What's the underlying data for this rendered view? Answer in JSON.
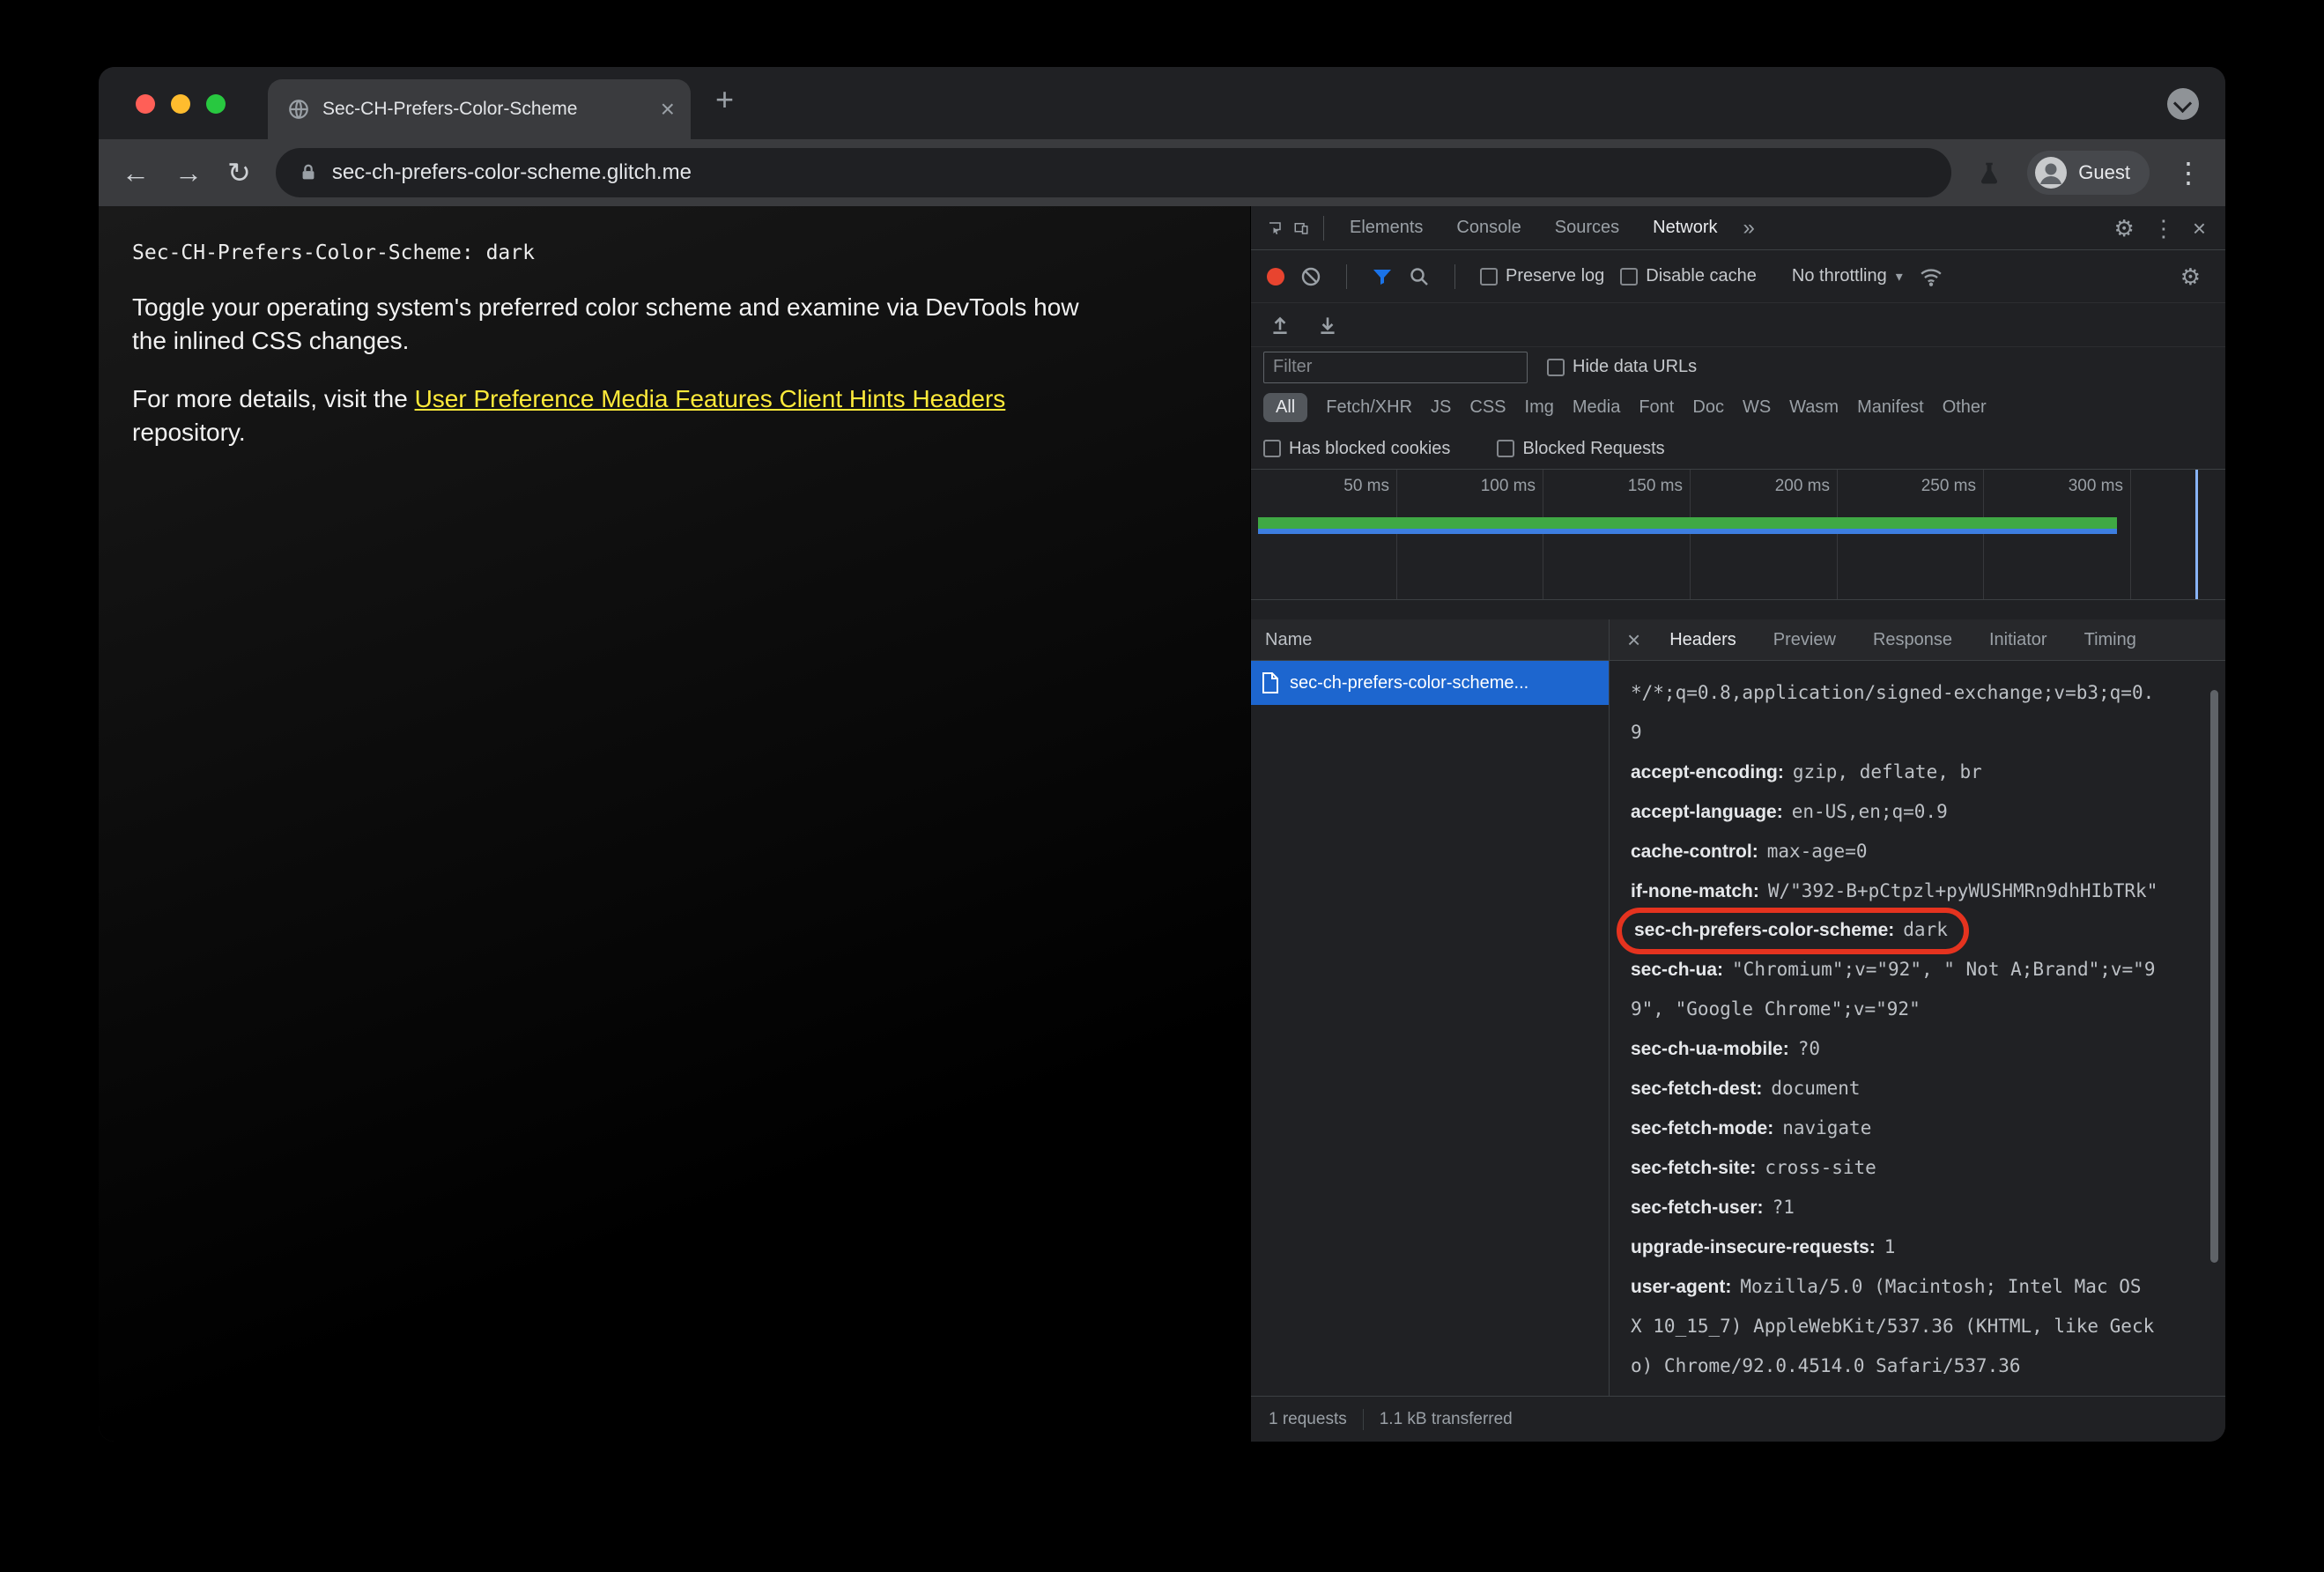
{
  "icons": {
    "close": "×",
    "plus": "+",
    "back": "←",
    "forward": "→",
    "reload": "↻",
    "kebab": "⋮",
    "gear": "⚙",
    "more_tabs": "»",
    "caret": "▾"
  },
  "browser": {
    "tab_title": "Sec-CH-Prefers-Color-Scheme",
    "url": "sec-ch-prefers-color-scheme.glitch.me",
    "profile_label": "Guest"
  },
  "page": {
    "mono_line": "Sec-CH-Prefers-Color-Scheme: dark",
    "para1_line1": "Toggle your operating system's preferred color scheme and examine via DevTools how",
    "para1_line2": "the inlined CSS changes.",
    "para2_prefix": "For more details, visit the ",
    "para2_link": "User Preference Media Features Client Hints Headers",
    "para2_suffix": "repository."
  },
  "devtools": {
    "main_tabs": [
      "Elements",
      "Console",
      "Sources",
      "Network"
    ],
    "selected_main_tab": "Network",
    "controls": {
      "preserve_log": "Preserve log",
      "disable_cache": "Disable cache",
      "throttling": "No throttling"
    },
    "filter": {
      "placeholder": "Filter",
      "hide_data_urls": "Hide data URLs"
    },
    "type_filters": [
      "All",
      "Fetch/XHR",
      "JS",
      "CSS",
      "Img",
      "Media",
      "Font",
      "Doc",
      "WS",
      "Wasm",
      "Manifest",
      "Other"
    ],
    "selected_type_filter": "All",
    "blocked_options": [
      "Has blocked cookies",
      "Blocked Requests"
    ],
    "timeline_labels": [
      "50 ms",
      "100 ms",
      "150 ms",
      "200 ms",
      "250 ms",
      "300 ms"
    ],
    "table": {
      "name_header": "Name",
      "request_name": "sec-ch-prefers-color-scheme..."
    },
    "detail_tabs": [
      "Headers",
      "Preview",
      "Response",
      "Initiator",
      "Timing"
    ],
    "selected_detail_tab": "Headers",
    "request_headers": [
      {
        "name": "",
        "value": "*/*;q=0.8,application/signed-exchange;v=b3;q=0.9"
      },
      {
        "name": "accept-encoding:",
        "value": "gzip, deflate, br"
      },
      {
        "name": "accept-language:",
        "value": "en-US,en;q=0.9"
      },
      {
        "name": "cache-control:",
        "value": "max-age=0"
      },
      {
        "name": "if-none-match:",
        "value": "W/\"392-B+pCtpzl+pyWUSHMRn9dhHIbTRk\""
      },
      {
        "name": "sec-ch-prefers-color-scheme:",
        "value": "dark"
      },
      {
        "name": "sec-ch-ua:",
        "value": "\"Chromium\";v=\"92\", \" Not A;Brand\";v=\"99\", \"Google Chrome\";v=\"92\""
      },
      {
        "name": "sec-ch-ua-mobile:",
        "value": "?0"
      },
      {
        "name": "sec-fetch-dest:",
        "value": "document"
      },
      {
        "name": "sec-fetch-mode:",
        "value": "navigate"
      },
      {
        "name": "sec-fetch-site:",
        "value": "cross-site"
      },
      {
        "name": "sec-fetch-user:",
        "value": "?1"
      },
      {
        "name": "upgrade-insecure-requests:",
        "value": "1"
      },
      {
        "name": "user-agent:",
        "value": "Mozilla/5.0 (Macintosh; Intel Mac OS X 10_15_7) AppleWebKit/537.36 (KHTML, like Gecko) Chrome/92.0.4514.0 Safari/537.36"
      }
    ],
    "status": {
      "requests": "1 requests",
      "transferred": "1.1 kB transferred"
    }
  },
  "colors": {
    "accent_blue": "#1a73e8",
    "record_red": "#e8442f",
    "annotation_red": "#e5331f",
    "timeline_green": "#3fa944",
    "link_yellow": "#feea3a",
    "selected_row_blue": "#1d66cf"
  }
}
